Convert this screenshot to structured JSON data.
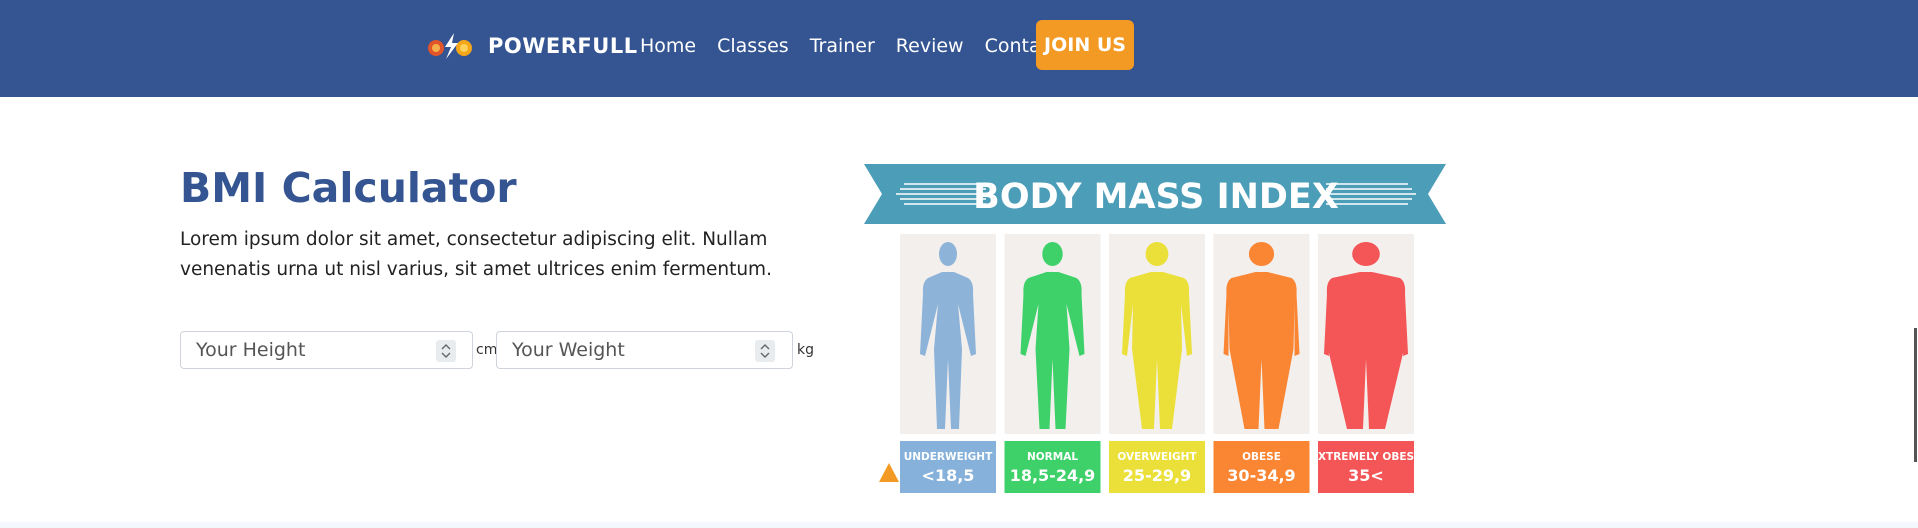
{
  "header": {
    "brand": "POWERFULL",
    "nav": [
      "Home",
      "Classes",
      "Trainer",
      "Review",
      "Contact"
    ],
    "cta": "JOIN US"
  },
  "bmi": {
    "title": "BMI Calculator",
    "description": "Lorem ipsum dolor sit amet, consectetur adipiscing elit. Nullam venenatis urna ut nisl varius, sit amet ultrices enim fermentum.",
    "height_placeholder": "Your Height",
    "height_unit": "cm",
    "weight_placeholder": "Your Weight",
    "weight_unit": "kg"
  },
  "graphic": {
    "banner": "BODY MASS INDEX",
    "categories": [
      {
        "label": "UNDERWEIGHT",
        "range": "<18,5",
        "color": "#86b1db",
        "body": "#8db3d9"
      },
      {
        "label": "NORMAL",
        "range": "18,5-24,9",
        "color": "#3ed16a",
        "body": "#3ed16a"
      },
      {
        "label": "OVERWEIGHT",
        "range": "25-29,9",
        "color": "#ebe03a",
        "body": "#ebe03a"
      },
      {
        "label": "OBESE",
        "range": "30-34,9",
        "color": "#fa8532",
        "body": "#fa8532"
      },
      {
        "label": "EXTREMELY OBESE",
        "range": "35<",
        "color": "#f45556",
        "body": "#f45556"
      }
    ]
  },
  "colors": {
    "navbar": "#345592",
    "accent": "#f39a24",
    "banner": "#4b9db8",
    "panel": "#f3efed"
  },
  "icons": [
    "brand-logo-icon",
    "spinner-icon",
    "pointer-triangle-icon"
  ]
}
